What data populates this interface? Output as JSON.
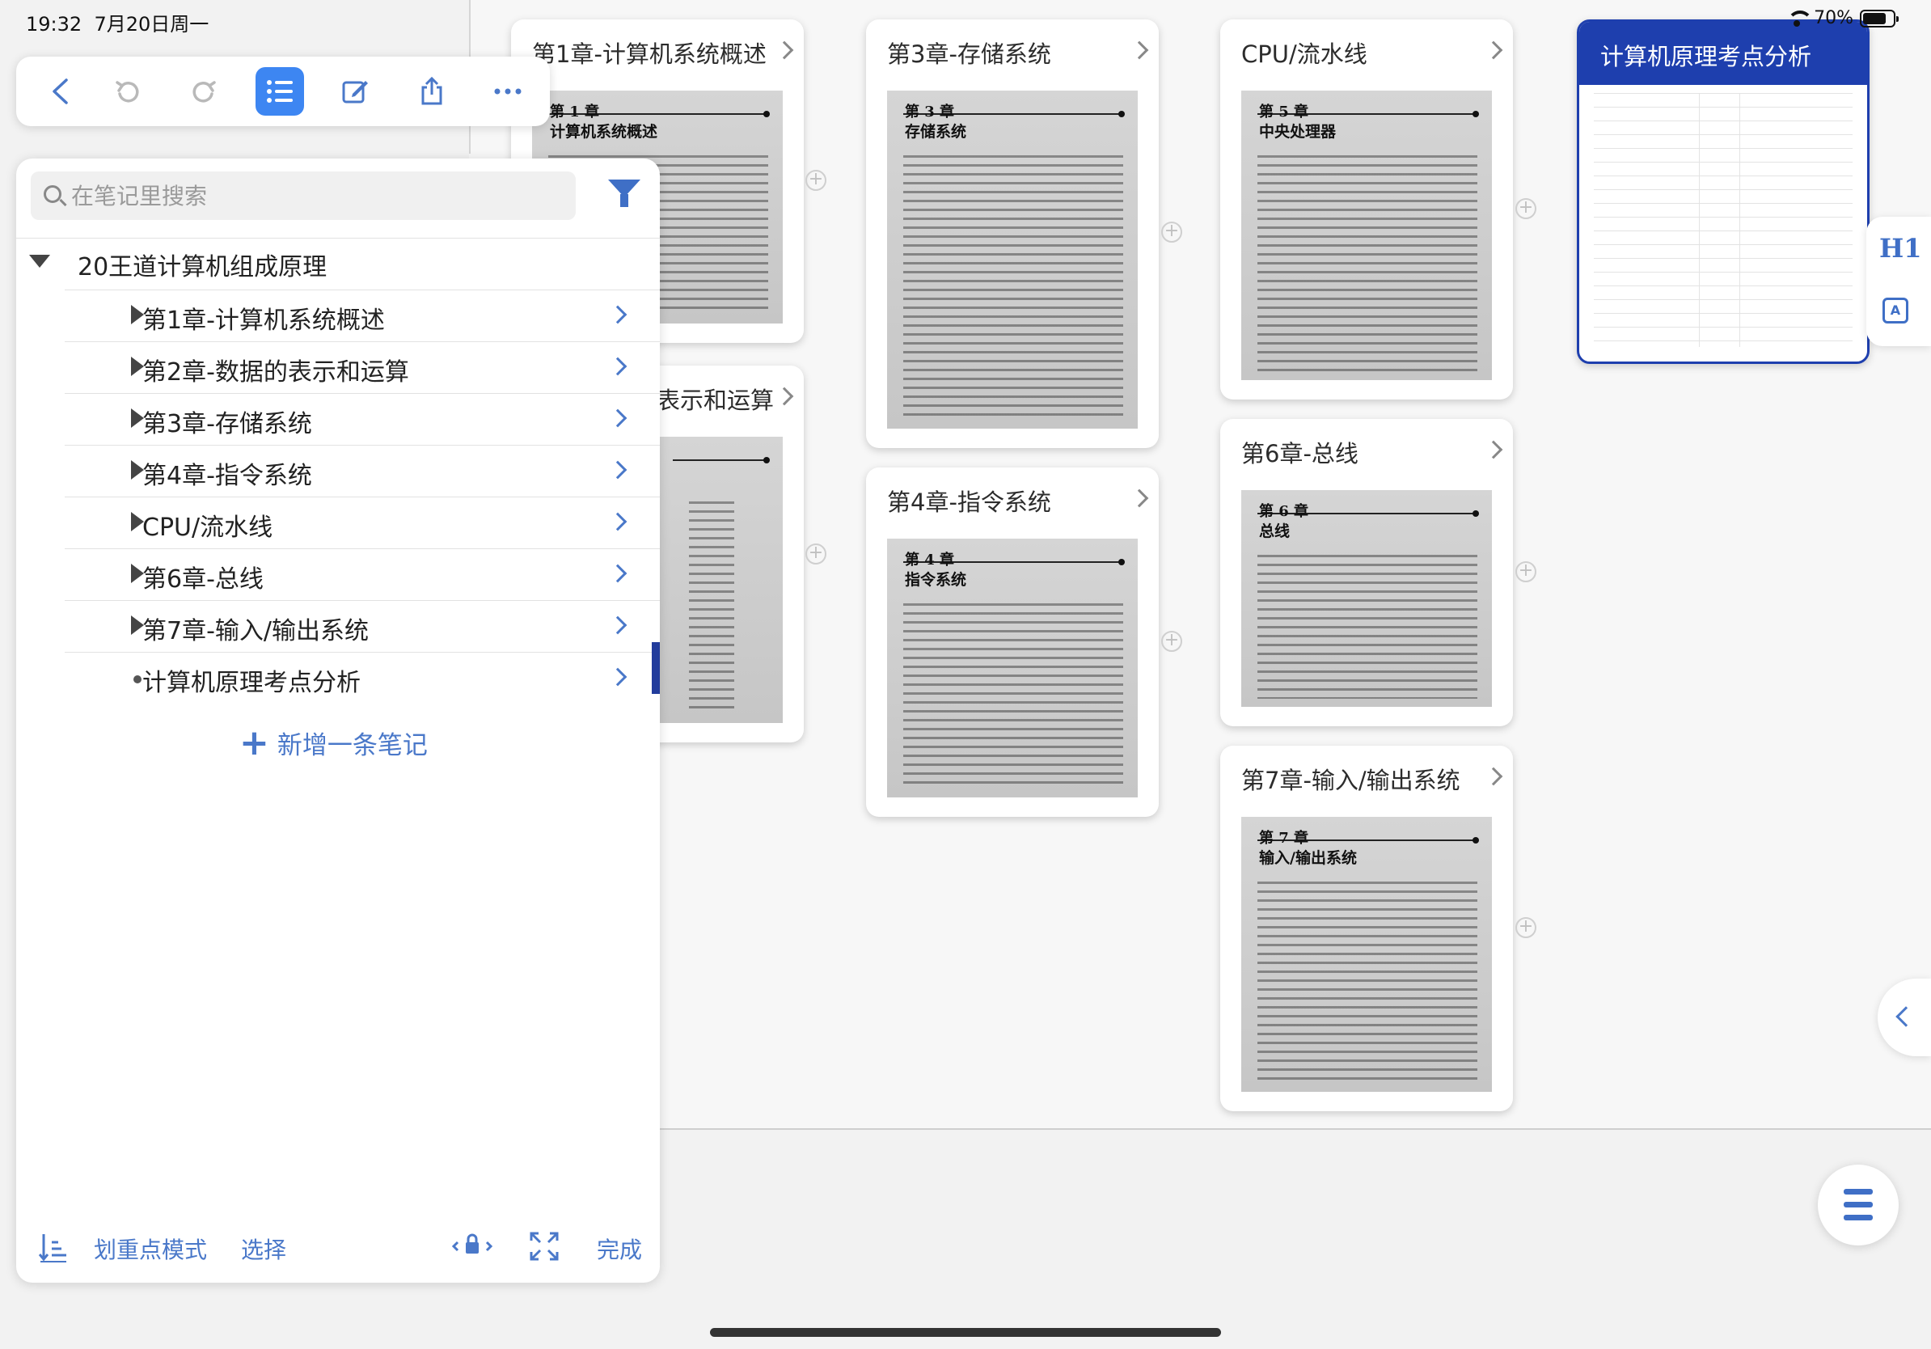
{
  "status_bar": {
    "time": "19:32",
    "date": "7月20日周一",
    "battery": "70%"
  },
  "toolbar": {
    "icons": [
      "back-icon",
      "undo-icon",
      "redo-icon",
      "outline-list-icon",
      "edit-icon",
      "share-icon",
      "more-icon"
    ]
  },
  "panel": {
    "search_placeholder": "在笔记里搜索",
    "root_label": "20王道计算机组成原理",
    "items": [
      {
        "label": "第1章-计算机系统概述"
      },
      {
        "label": "第2章-数据的表示和运算"
      },
      {
        "label": "第3章-存储系统"
      },
      {
        "label": "第4章-指令系统"
      },
      {
        "label": "CPU/流水线"
      },
      {
        "label": "第6章-总线"
      },
      {
        "label": "第7章-输入/输出系统"
      },
      {
        "label": "计算机原理考点分析"
      }
    ],
    "add_note": "新增一条笔记",
    "bottom": {
      "highlight_mode": "划重点模式",
      "select": "选择",
      "done": "完成"
    }
  },
  "canvas": {
    "cards": [
      {
        "title": "第1章-计算机系统概述",
        "chapter_no": "第 1 章",
        "chapter_name": "计算机系统概述"
      },
      {
        "title": "表示和运算"
      },
      {
        "title": "第3章-存储系统",
        "chapter_no": "第 3 章",
        "chapter_name": "存储系统"
      },
      {
        "title": "第4章-指令系统",
        "chapter_no": "第 4 章",
        "chapter_name": "指令系统"
      },
      {
        "title": "CPU/流水线",
        "chapter_no": "第 5 章",
        "chapter_name": "中央处理器"
      },
      {
        "title": "第6章-总线",
        "chapter_no": "第 6 章",
        "chapter_name": "总线"
      },
      {
        "title": "第7章-输入/输出系统",
        "chapter_no": "第 7 章",
        "chapter_name": "输入/输出系统"
      },
      {
        "title": "计算机原理考点分析"
      }
    ]
  },
  "side_tools": {
    "heading": "H1"
  },
  "colors": {
    "accent": "#3d86f2",
    "link": "#4a78c9",
    "card_blue": "#1e3fae"
  }
}
